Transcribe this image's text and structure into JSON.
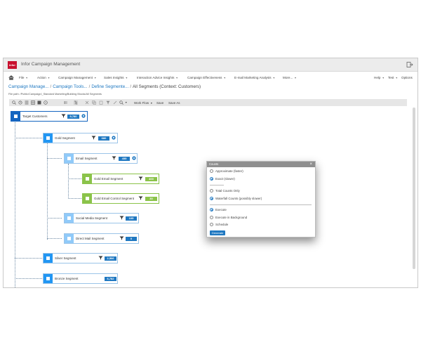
{
  "app": {
    "logo_text": "infor",
    "title": "Infor Campaign Management"
  },
  "menu": {
    "items": [
      "File",
      "Action",
      "Campaign Management",
      "Sales Insights",
      "Interaction Advice Insights",
      "Campaign Effectiveness",
      "E-mail Marketing Analysis",
      "More..."
    ],
    "right_items": [
      "Help",
      "Test",
      "Options"
    ]
  },
  "breadcrumb": {
    "links": [
      "Campaign Manage...",
      "Campaign Tools...",
      "Define Segmente..."
    ],
    "current": "All Segments (Context: Customers)"
  },
  "file_path": "File path: /Public/Campaign/_Standard Marketing/Building Blocks/All Segments",
  "toolbar": {
    "workflow_label": "Work Flow",
    "save_label": "Save",
    "save_as_label": "Save As"
  },
  "segments": {
    "target": {
      "label": "Target Customers",
      "count": "9,780"
    },
    "gold": {
      "label": "Gold Segment",
      "count": "680"
    },
    "email": {
      "label": "Email Segment",
      "count": "455"
    },
    "gold_email": {
      "label": "Gold Email Segment",
      "count": "400"
    },
    "gold_email_control": {
      "label": "Gold Email Control Segment",
      "count": "30"
    },
    "social": {
      "label": "Social Media Segment",
      "count": "105"
    },
    "direct_mail": {
      "label": "Direct Mail Segment",
      "count": "0"
    },
    "silver": {
      "label": "Silver Segment",
      "count": "2,506"
    },
    "bronze": {
      "label": "Bronze Segment",
      "count": "6,782"
    }
  },
  "colors": {
    "accent": "#1f78c1",
    "root_tile": "#1565c0",
    "tile_gold": "#2196f3",
    "tile_light": "#90caf9",
    "tile_green": "#8bc34a"
  },
  "counts_dialog": {
    "title": "Counts",
    "options_precision": [
      "Approximate (faster)",
      "Exact (slower)"
    ],
    "options_type": [
      "Total Counts Only",
      "Waterfall Counts (possibly slower)"
    ],
    "options_exec": [
      "Execute",
      "Execute in Background",
      "Schedule"
    ],
    "selected": {
      "precision": "Exact (slower)",
      "type": "Waterfall Counts (possibly slower)",
      "exec": "Execute"
    },
    "generate_label": "Generate"
  }
}
